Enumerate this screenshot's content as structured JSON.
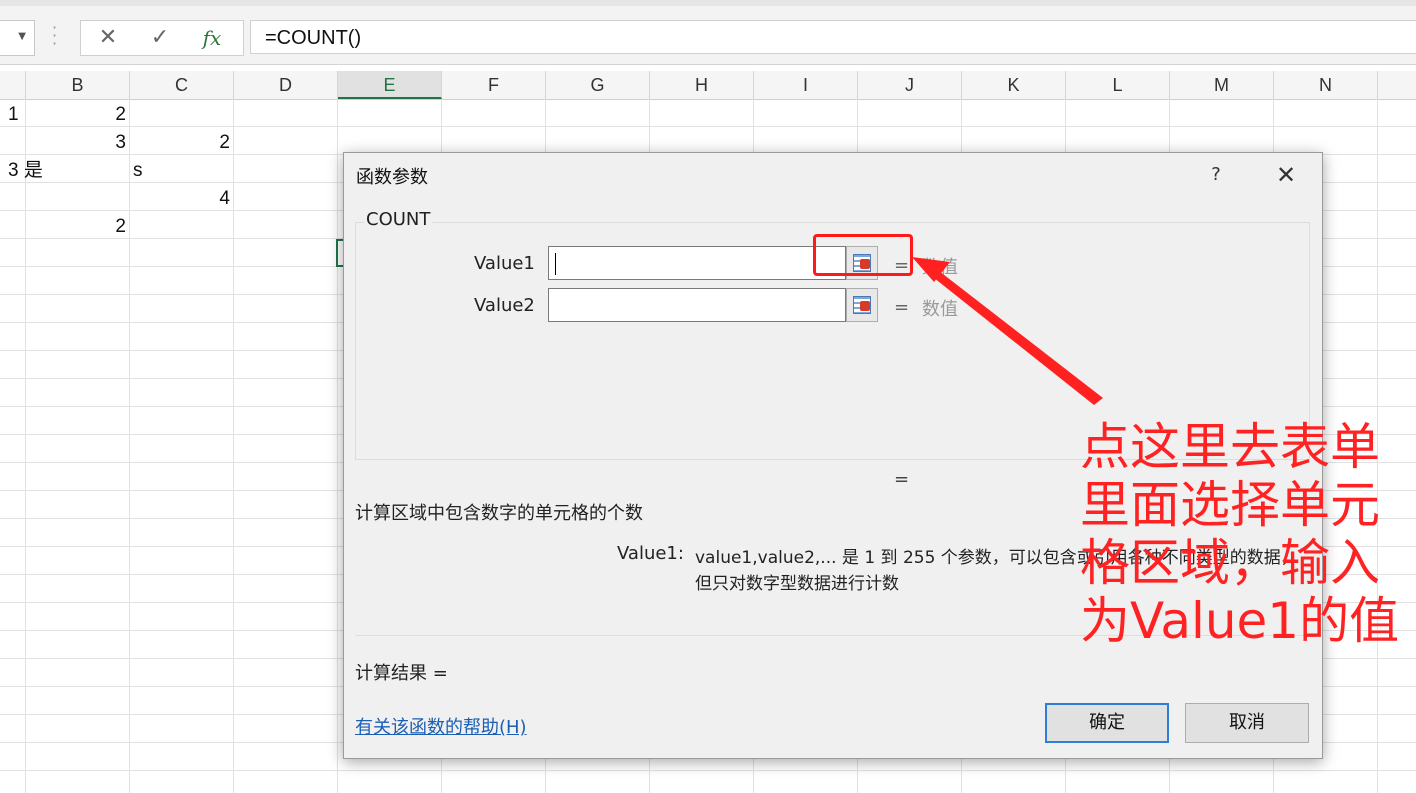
{
  "formula_bar": {
    "formula": "=COUNT()",
    "cancel_icon": "close-icon",
    "enter_icon": "check-icon",
    "fx_label": "fx"
  },
  "grid": {
    "columns": [
      "B",
      "C",
      "D",
      "E",
      "F",
      "G",
      "H",
      "I",
      "J",
      "K",
      "L",
      "M",
      "N"
    ],
    "selected_column": "E",
    "cells": {
      "r1a": "1",
      "r1b": "2",
      "r2b": "3",
      "r2c": "2",
      "r3a": "3 是",
      "r3c": "s",
      "r4c": "4",
      "r5b": "2"
    }
  },
  "dialog": {
    "title": "函数参数",
    "help_glyph": "?",
    "close_glyph": "✕",
    "function_name": "COUNT",
    "args": [
      {
        "label": "Value1",
        "value": "",
        "eq": "=",
        "type": "数值"
      },
      {
        "label": "Value2",
        "value": "",
        "eq": "=",
        "type": "数值"
      }
    ],
    "result_eq": "=",
    "description": "计算区域中包含数字的单元格的个数",
    "param_name": "Value1:",
    "param_desc_line1": "value1,value2,... 是 1 到 255 个参数，可以包含或引用各种不同类型的数据，",
    "param_desc_line2": "但只对数字型数据进行计数",
    "calc_result": "计算结果 =",
    "help_link": "有关该函数的帮助(H)",
    "ok_label": "确定",
    "cancel_label": "取消"
  },
  "annotation": {
    "color": "#ff2222",
    "lines": [
      "点这里去表单",
      "里面选择单元",
      "格区域，输入",
      "为Value1的值"
    ]
  }
}
